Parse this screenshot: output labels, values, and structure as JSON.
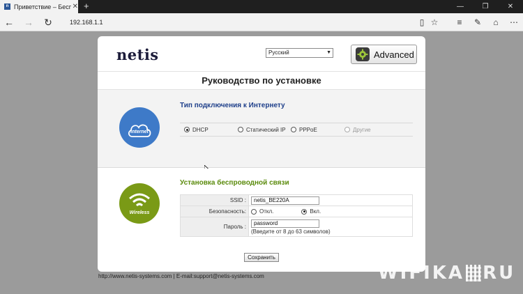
{
  "browser": {
    "tab_title": "Приветствие – Беспро",
    "address": "192.168.1.1"
  },
  "page": {
    "logo": "netis",
    "language": "Русский",
    "advanced_label": "Advanced",
    "title": "Руководство по установке",
    "internet": {
      "icon_label": "internet",
      "section_title": "Тип подключения к Интернету",
      "options": [
        {
          "label": "DHCP",
          "selected": true
        },
        {
          "label": "Статический IP",
          "selected": false
        },
        {
          "label": "PPPoE",
          "selected": false
        },
        {
          "label": "Другие",
          "selected": false,
          "disabled": true
        }
      ]
    },
    "wireless": {
      "icon_label": "Wireless",
      "section_title": "Установка беспроводной связи",
      "ssid_label": "SSID :",
      "ssid_value": "netis_BE220A",
      "security_label": "Безопасность:",
      "security_off": "Откл.",
      "security_on": "Вкл.",
      "password_label": "Пароль :",
      "password_value": "password",
      "password_hint": "(Введите от 8 до 63 символов)"
    },
    "save_label": "Сохранить",
    "footer": "http://www.netis-systems.com | E-mail:support@netis-systems.com",
    "watermark_left": "WIFIKA",
    "watermark_right": "RU"
  },
  "colors": {
    "internet_circle": "#3e7ac8",
    "wireless_circle": "#7a9a16",
    "internet_title": "#1e3f8a",
    "wireless_title": "#5a8a0b"
  }
}
